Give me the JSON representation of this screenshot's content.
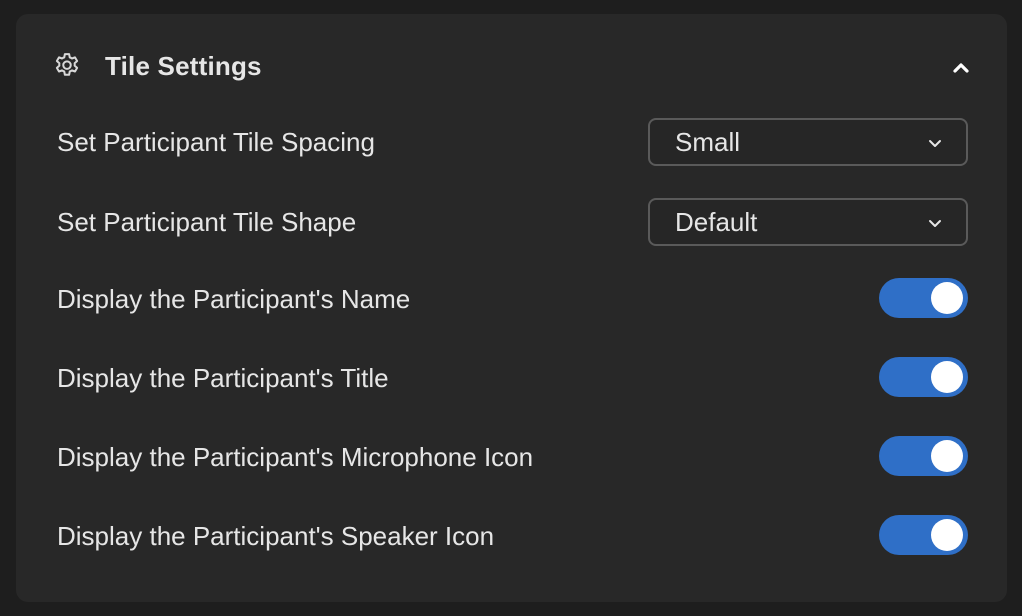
{
  "section": {
    "title": "Tile Settings",
    "expanded": true,
    "icon": "gear-icon",
    "collapse_icon": "chevron-up-icon"
  },
  "settings": {
    "spacing": {
      "label": "Set Participant Tile Spacing",
      "value": "Small"
    },
    "shape": {
      "label": "Set Participant Tile Shape",
      "value": "Default"
    },
    "show_name": {
      "label": "Display the Participant's Name",
      "on": true
    },
    "show_title": {
      "label": "Display the Participant's Title",
      "on": true
    },
    "show_mic": {
      "label": "Display the Participant's Microphone Icon",
      "on": true
    },
    "show_speaker": {
      "label": "Display the Participant's Speaker Icon",
      "on": true
    }
  },
  "colors": {
    "toggle_on": "#2f6fc7",
    "panel_bg": "#282828",
    "text": "#e6e6e6"
  }
}
